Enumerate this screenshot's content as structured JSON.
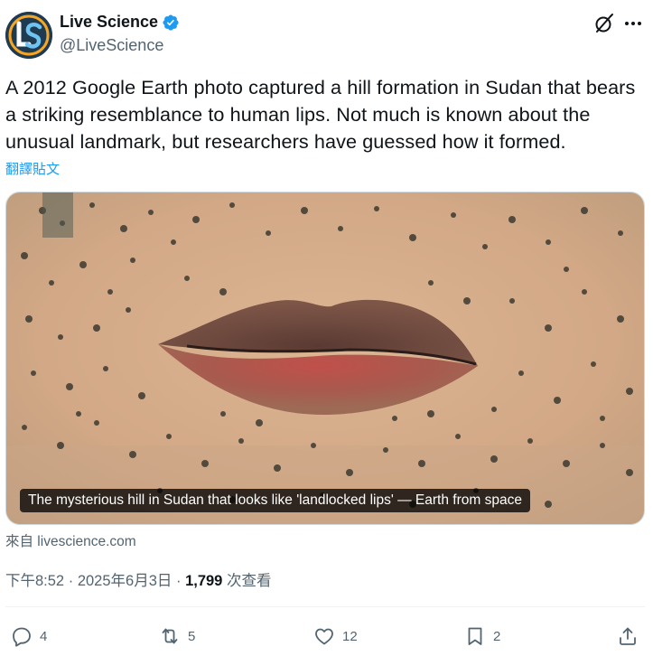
{
  "author": {
    "display_name": "Live Science",
    "handle": "@LiveScience",
    "avatar_icon": "live-science-logo",
    "verified_icon": "verified-badge-icon"
  },
  "tweet": {
    "text": "A 2012 Google Earth photo captured a hill formation in Sudan that bears a striking resemblance to human lips. Not much is known about the unusual landmark, but researchers have guessed how it formed.",
    "translate_label": "翻譯貼文",
    "media_caption": "The mysterious hill in Sudan that looks like 'landlocked lips' — Earth from space",
    "source_label": "來自 livescience.com",
    "time": "下午8:52",
    "date": "2025年6月3日",
    "separator": "·",
    "views_count": "1,799",
    "views_label": "次查看"
  },
  "actions": {
    "replies": "4",
    "reposts": "5",
    "likes": "12",
    "bookmarks": "2"
  },
  "colors": {
    "accent": "#1d9bf0",
    "text": "#0f1419",
    "muted": "#536471"
  }
}
